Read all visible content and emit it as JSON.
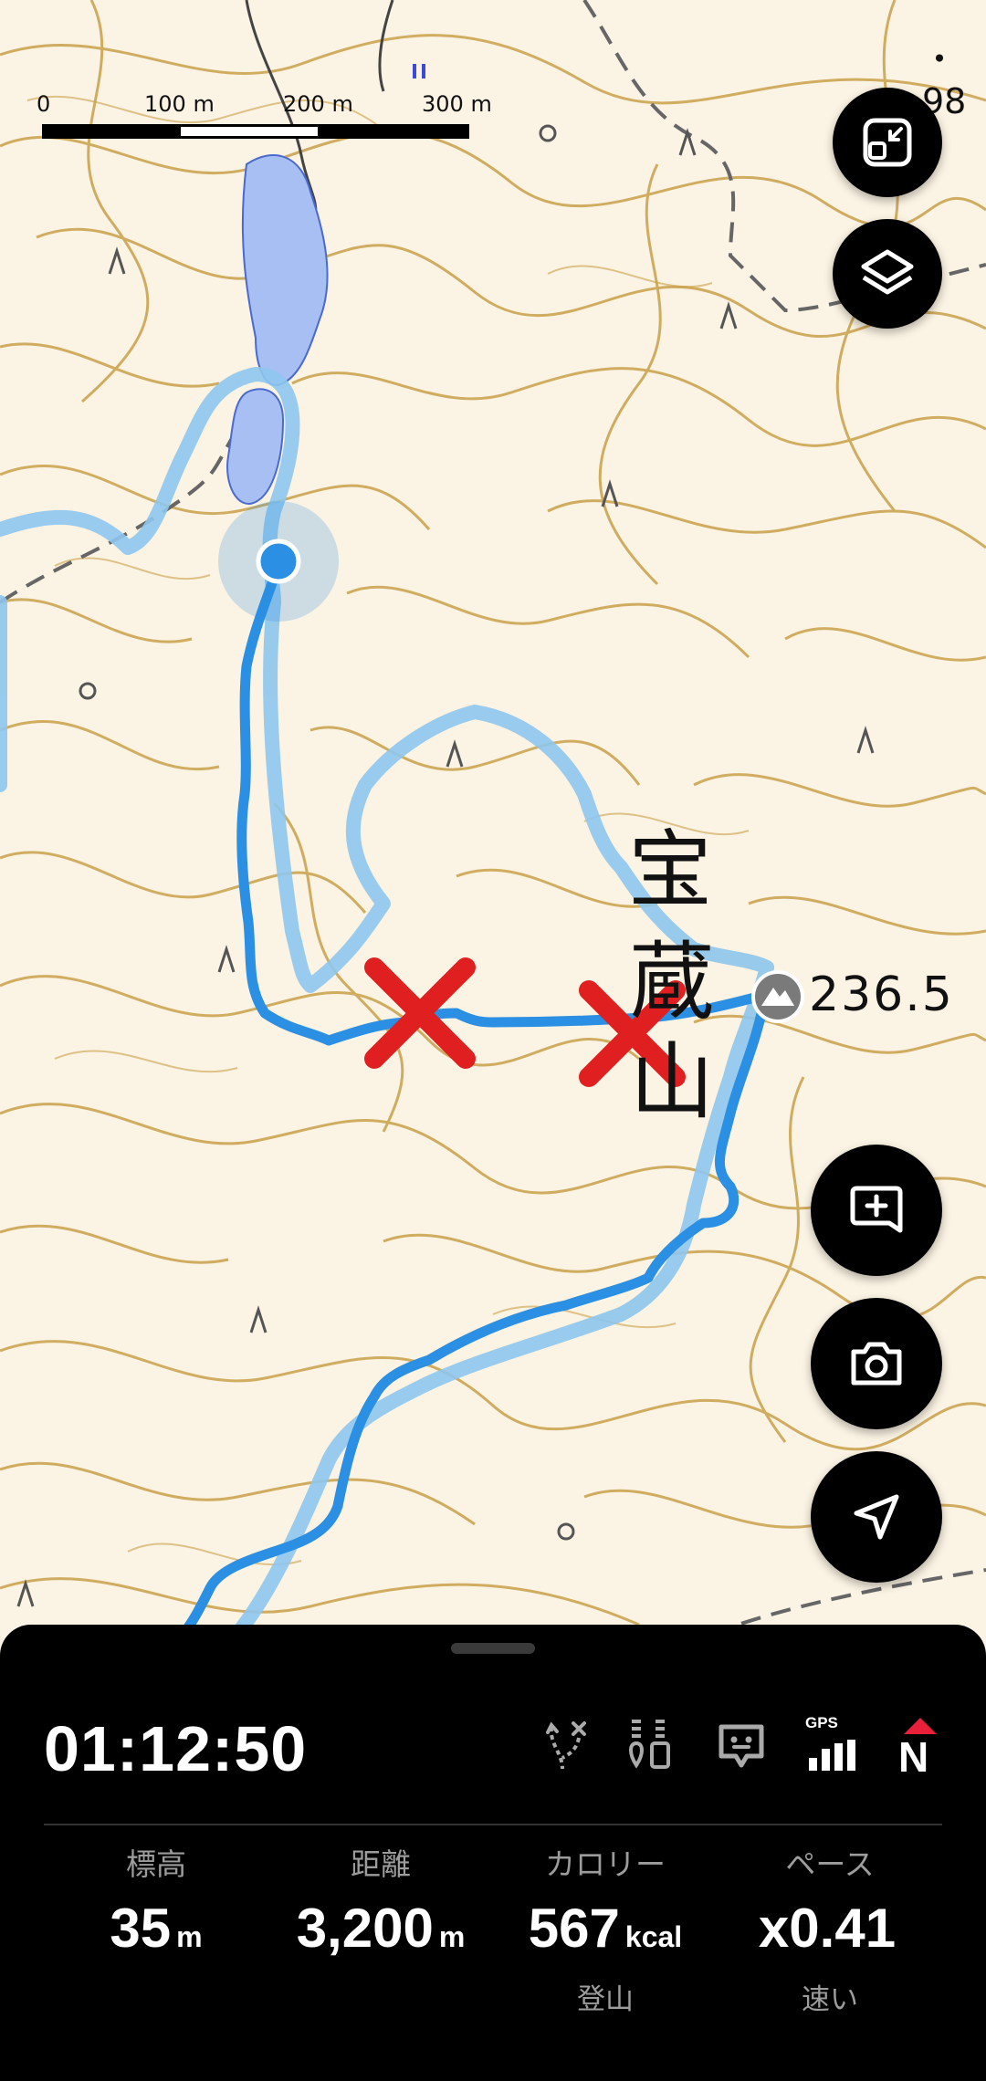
{
  "map": {
    "scale": {
      "labels": [
        "0",
        "100 m",
        "200 m",
        "300 m"
      ]
    },
    "peak": {
      "elevation_label": "236.5"
    },
    "mountain_name": [
      "宝",
      "蔵",
      "山"
    ],
    "edge_label": "・98",
    "colors": {
      "track": "#2b8fe3",
      "route": "#8ec6ee",
      "contour": "#c9a04a",
      "marker": "#e02020",
      "water": "#a7bff2"
    }
  },
  "fabs": [
    {
      "icon": "fit-map-icon"
    },
    {
      "icon": "layers-icon"
    },
    {
      "icon": "add-memo-icon"
    },
    {
      "icon": "camera-icon"
    },
    {
      "icon": "navigation-icon"
    }
  ],
  "panel": {
    "elapsed_time": "01:12:50",
    "status_icons": [
      "route-off-icon",
      "location-share-icon",
      "face-status-icon",
      "gps-signal-icon",
      "compass-north-icon"
    ],
    "gps_label": "GPS",
    "compass_label": "N",
    "stats": [
      {
        "label": "標高",
        "value": "35",
        "unit": "m",
        "sub": ""
      },
      {
        "label": "距離",
        "value": "3,200",
        "unit": "m",
        "sub": ""
      },
      {
        "label": "カロリー",
        "value": "567",
        "unit": "kcal",
        "sub": "登山"
      },
      {
        "label": "ペース",
        "value": "x0.41",
        "unit": "",
        "sub": "速い"
      }
    ]
  }
}
